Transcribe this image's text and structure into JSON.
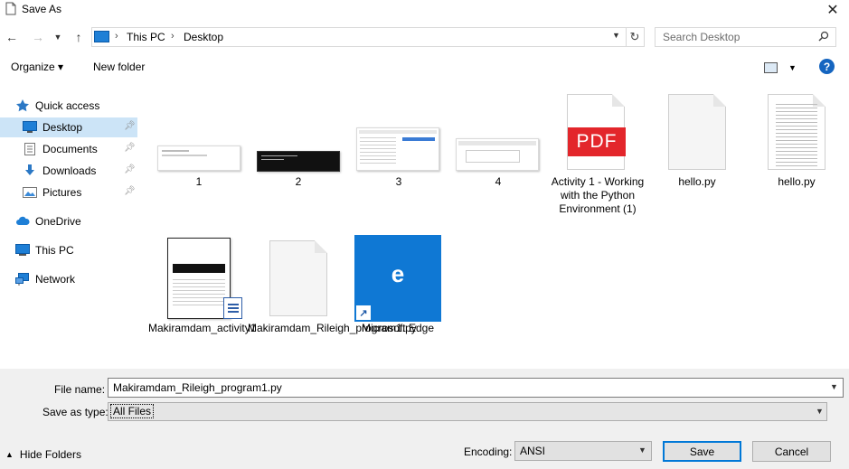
{
  "window": {
    "title": "Save As",
    "close_glyph": "✕"
  },
  "nav": {
    "back_glyph": "←",
    "forward_glyph": "→",
    "recent_glyph": "⌄",
    "up_glyph": "↑",
    "breadcrumb": [
      "This PC",
      "Desktop"
    ],
    "refresh_glyph": "↻",
    "search_placeholder": "Search Desktop"
  },
  "toolbar": {
    "organize": "Organize ▾",
    "new_folder": "New folder",
    "help": "?"
  },
  "sidebar": {
    "items": [
      {
        "label": "Quick access",
        "icon": "star-icon"
      },
      {
        "label": "Desktop",
        "icon": "desktop-icon",
        "pinned": true
      },
      {
        "label": "Documents",
        "icon": "documents-icon",
        "pinned": true
      },
      {
        "label": "Downloads",
        "icon": "downloads-icon",
        "pinned": true
      },
      {
        "label": "Pictures",
        "icon": "pictures-icon",
        "pinned": true
      },
      {
        "label": "OneDrive",
        "icon": "cloud-icon"
      },
      {
        "label": "This PC",
        "icon": "pc-icon"
      },
      {
        "label": "Network",
        "icon": "network-icon"
      }
    ]
  },
  "files": [
    {
      "name": "1",
      "type": "image"
    },
    {
      "name": "2",
      "type": "image"
    },
    {
      "name": "3",
      "type": "image"
    },
    {
      "name": "4",
      "type": "image"
    },
    {
      "name": "Activity 1 - Working with the Python Environment (1)",
      "type": "pdf",
      "badge": "PDF"
    },
    {
      "name": "hello.py",
      "type": "py"
    },
    {
      "name": "hello.py",
      "type": "py-text"
    },
    {
      "name": "Makiramdam_activity1",
      "type": "document"
    },
    {
      "name": "Makiramdam_Rileigh_program1.py",
      "type": "py"
    },
    {
      "name": "Microsoft Edge",
      "type": "shortcut",
      "badge": "e"
    }
  ],
  "bottom": {
    "file_name_label": "File name:",
    "file_name_value": "Makiramdam_Rileigh_program1.py",
    "save_type_label": "Save as type:",
    "save_type_value": "All Files",
    "hide_folders": "Hide Folders",
    "encoding_label": "Encoding:",
    "encoding_value": "ANSI",
    "save_button": "Save",
    "cancel_button": "Cancel"
  },
  "colors": {
    "accent": "#0078d7",
    "selection": "#cce4f7",
    "pdf_red": "#e3262b",
    "edge_blue": "#0f78d4"
  }
}
